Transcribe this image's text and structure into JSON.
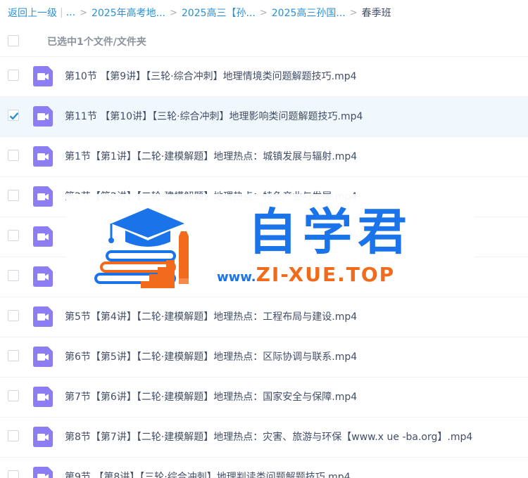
{
  "breadcrumb": {
    "back_label": "返回上一级",
    "ellipsis": "...",
    "crumbs": [
      "2025年高考地...",
      "2025高三【孙...",
      "2025高三孙国..."
    ],
    "current": "春季班"
  },
  "selection": {
    "text": "已选中1个文件/文件夹"
  },
  "files": [
    {
      "name": "第10节 【第9讲】【三轮·综合冲刺】地理情境类问题解题技巧.mp4",
      "checked": false
    },
    {
      "name": "第11节 【第10讲】【三轮·综合冲刺】地理影响类问题解题技巧.mp4",
      "checked": true
    },
    {
      "name": "第1节【第1讲】【二轮·建模解题】地理热点：城镇发展与辐射.mp4",
      "checked": false
    },
    {
      "name": "第2节【第2讲】【二轮·建模解题】地理热点：特色产业与发展.mp4",
      "checked": false
    },
    {
      "name": "",
      "checked": false
    },
    {
      "name": "",
      "checked": false
    },
    {
      "name": "第5节【第4讲】【二轮·建模解题】地理热点：工程布局与建设.mp4",
      "checked": false
    },
    {
      "name": "第6节【第5讲】【二轮·建模解题】地理热点：区际协调与联系.mp4",
      "checked": false
    },
    {
      "name": "第7节【第6讲】【二轮·建模解题】地理热点：国家安全与保障.mp4",
      "checked": false
    },
    {
      "name": "第8节【第7讲】【二轮·建模解题】地理热点：灾害、旅游与环保【www.x ue -ba.org】.mp4",
      "checked": false
    },
    {
      "name": "第9节 【第8讲】【三轮·综合冲刺】地理判读类问题解题技巧.mp4",
      "checked": false
    }
  ],
  "watermark": {
    "brand": "自学君",
    "url_prefix": "www.",
    "url_domain": "ZI-XUE.TOP"
  },
  "icons": {
    "file_icon": "video-file-icon",
    "checkbox": "check-icon"
  },
  "colors": {
    "link": "#2b8fd6",
    "text": "#424e67",
    "video_icon": "#8c7ef2",
    "checkbox_checked": "#2b8fd6",
    "selected_row": "#f1f8fd",
    "watermark_blue": "#1a73e8",
    "watermark_orange": "#f26b1d"
  }
}
